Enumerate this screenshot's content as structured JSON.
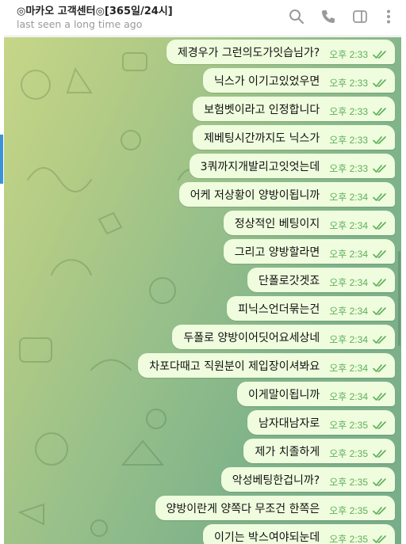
{
  "header": {
    "title": "◎마카오 고객센터◎[365일/24시]",
    "status": "last seen a long time ago",
    "icons": [
      "search-icon",
      "phone-icon",
      "sidebar-panel-icon",
      "more-vert-icon"
    ]
  },
  "colors": {
    "accent": "#3a93d6",
    "bubble": "#effdde",
    "time": "#5fae5a",
    "header_status": "#999999"
  },
  "messages": [
    {
      "text": "제경우가 그런의도가잇습님가?",
      "time": "오후 2:33",
      "status": "read"
    },
    {
      "text": "닉스가 이기고있었우면",
      "time": "오후 2:33",
      "status": "read"
    },
    {
      "text": "보험벳이라고 인정합니다",
      "time": "오후 2:33",
      "status": "read"
    },
    {
      "text": "제베팅시간까지도 닉스가",
      "time": "오후 2:33",
      "status": "read"
    },
    {
      "text": "3쿼까지개발리고잇엇는데",
      "time": "오후 2:33",
      "status": "read"
    },
    {
      "text": "어케 저상황이 양방이됩니까",
      "time": "오후 2:34",
      "status": "read"
    },
    {
      "text": "정상적인 베팅이지",
      "time": "오후 2:34",
      "status": "read"
    },
    {
      "text": "그리고 양방할라면",
      "time": "오후 2:34",
      "status": "read"
    },
    {
      "text": "단폴로갓겟죠",
      "time": "오후 2:34",
      "status": "read"
    },
    {
      "text": "피닉스언더묶는건",
      "time": "오후 2:34",
      "status": "read"
    },
    {
      "text": "두폴로 양방이어딧어요세상네",
      "time": "오후 2:34",
      "status": "read"
    },
    {
      "text": "차포다때고 직원분이 제입장이셔봐요",
      "time": "오후 2:34",
      "status": "read"
    },
    {
      "text": "이게말이됩니까",
      "time": "오후 2:34",
      "status": "read"
    },
    {
      "text": "남자대남자로",
      "time": "오후 2:35",
      "status": "read"
    },
    {
      "text": "제가 치졸하게",
      "time": "오후 2:35",
      "status": "read"
    },
    {
      "text": "악성베팅한겁니까?",
      "time": "오후 2:35",
      "status": "read"
    },
    {
      "text": "양방이란게 양쪽다 무조건 한쪽은",
      "time": "오후 2:35",
      "status": "read"
    },
    {
      "text": "이기는 박스여야되눈데",
      "time": "오후 2:35",
      "status": "read"
    }
  ]
}
